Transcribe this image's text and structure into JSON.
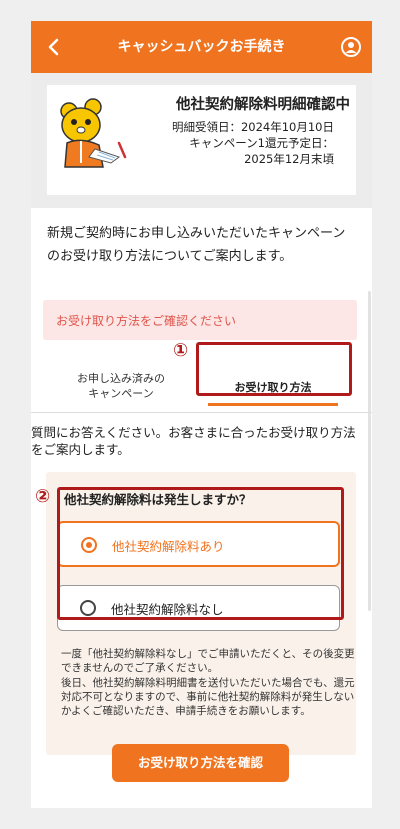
{
  "header": {
    "title": "キャッシュバックお手続き",
    "back_icon": "chevron-left-icon",
    "user_icon": "user-circle-icon",
    "color": "#f0731f"
  },
  "info_card": {
    "title": "他社契約解除料明細確認中",
    "receipt_date": "明細受領日：2024年10月10日",
    "refund_schedule": "キャンペーン1還元予定日：",
    "refund_date": "2025年12月末頃"
  },
  "intro_text": "新規ご契約時にお申し込みいただいたキャンペーンのお受け取り方法についてご案内します。",
  "alert_text": "お受け取り方法をご確認ください",
  "tabs": [
    {
      "label_line1": "お申し込み済みの",
      "label_line2": "キャンペーン"
    },
    {
      "label": "お受け取り方法"
    }
  ],
  "annotations": {
    "one": "①",
    "two": "②"
  },
  "guide_text": "質問にお答えください。お客さまに合ったお受け取り方法をご案内します。",
  "question": {
    "title": "他社契約解除料は発生しますか？",
    "options": [
      {
        "label": "他社契約解除料あり",
        "selected": true
      },
      {
        "label": "他社契約解除料なし",
        "selected": false
      }
    ]
  },
  "note": {
    "line1": "一度「他社契約解除料なし」でご申請いただくと、その後変更できませんのでご了承ください。",
    "line2": "後日、他社契約解除料明細書を送付いただいた場合でも、還元対応不可となりますので、事前に他社契約解除料が発生しないかよくご確認いただき、申請手続きをお願いします。"
  },
  "confirm_button": "お受け取り方法を確認"
}
